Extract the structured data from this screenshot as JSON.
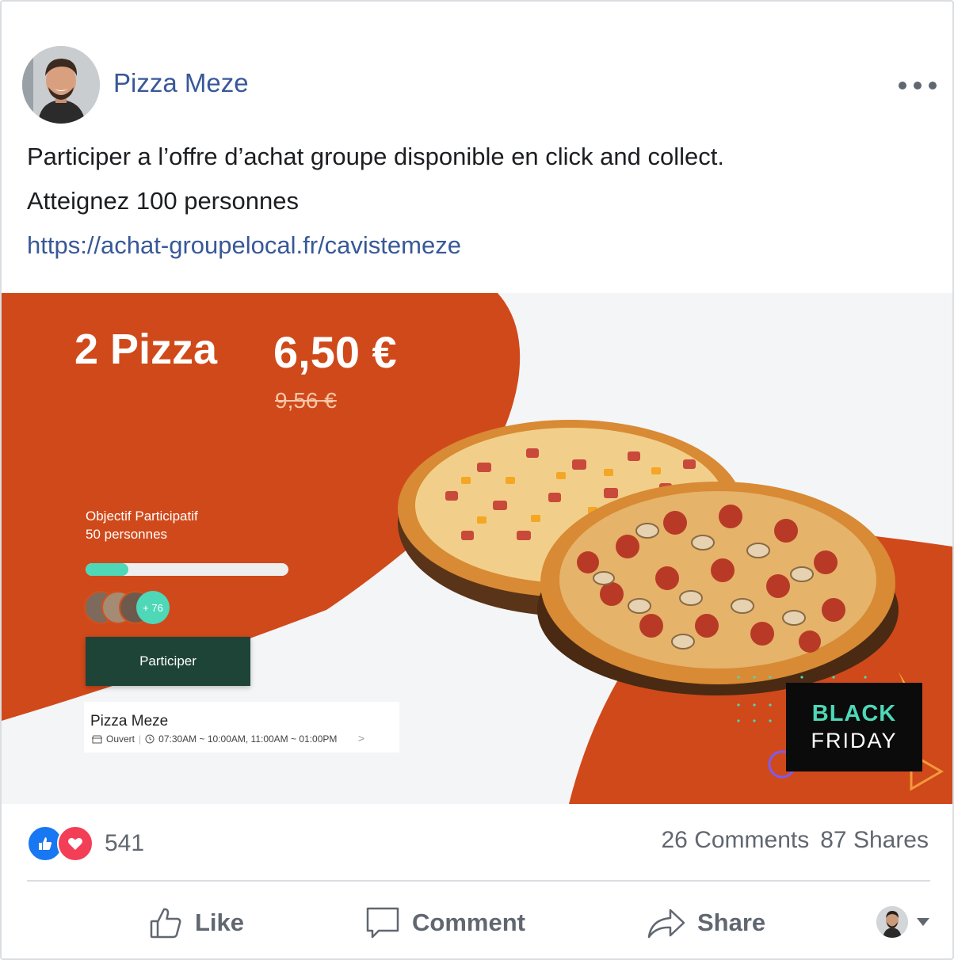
{
  "post": {
    "page_name": "Pizza Meze",
    "text_line_1": "Participer a l’offre d’achat groupe disponible en click and collect.",
    "text_line_2": "Atteignez 100 personnes",
    "link": "https://achat-groupelocal.fr/cavistemeze"
  },
  "banner": {
    "title": "2 Pizza",
    "price_new": "6,50 €",
    "price_old": "9,56 €",
    "goal_line_1": "Objectif Participatif",
    "goal_line_2": "50 personnes",
    "progress_fraction": 0.21,
    "participants_extra": "+ 76",
    "cta_label": "Participer",
    "store_name": "Pizza Meze",
    "store_status": "Ouvert",
    "store_hours": "07:30AM ~ 10:00AM, 11:00AM ~ 01:00PM",
    "store_arrow": ">",
    "badge_line_1": "BLACK",
    "badge_line_2": "FRIDAY",
    "colors": {
      "orange": "#d0491a",
      "green": "#4ed8b8",
      "dark_green": "#1e4438"
    }
  },
  "stats": {
    "reaction_count": "541",
    "comments": "26 Comments",
    "shares": "87 Shares",
    "reaction_icons": [
      "like-icon",
      "love-icon"
    ]
  },
  "actions": {
    "like": "Like",
    "comment": "Comment",
    "share": "Share"
  },
  "theme": {
    "link_color": "#385898",
    "muted": "#606770",
    "like_blue": "#1877f2",
    "love_red": "#f33e58"
  }
}
